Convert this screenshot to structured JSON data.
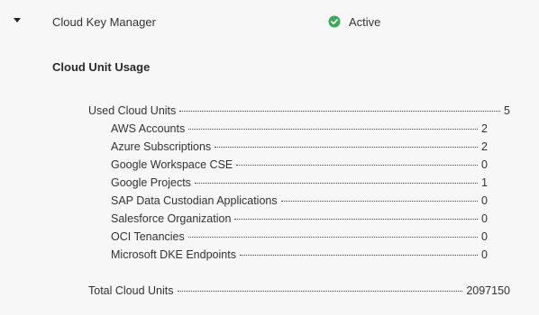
{
  "header": {
    "product": "Cloud Key Manager",
    "status": "Active",
    "status_color": "#3aaa5c",
    "expand_icon": "caret-down-icon",
    "status_icon": "check-circle-icon"
  },
  "usage": {
    "title": "Cloud Unit Usage",
    "used": {
      "label": "Used Cloud Units",
      "value": "5"
    },
    "items": [
      {
        "label": "AWS Accounts",
        "value": "2"
      },
      {
        "label": "Azure Subscriptions",
        "value": "2"
      },
      {
        "label": "Google Workspace CSE",
        "value": "0"
      },
      {
        "label": "Google Projects",
        "value": "1"
      },
      {
        "label": "SAP Data Custodian Applications",
        "value": "0"
      },
      {
        "label": "Salesforce Organization",
        "value": "0"
      },
      {
        "label": "OCI Tenancies",
        "value": "0"
      },
      {
        "label": "Microsoft DKE Endpoints",
        "value": "0"
      }
    ],
    "total": {
      "label": "Total Cloud Units",
      "value": "2097150"
    }
  }
}
